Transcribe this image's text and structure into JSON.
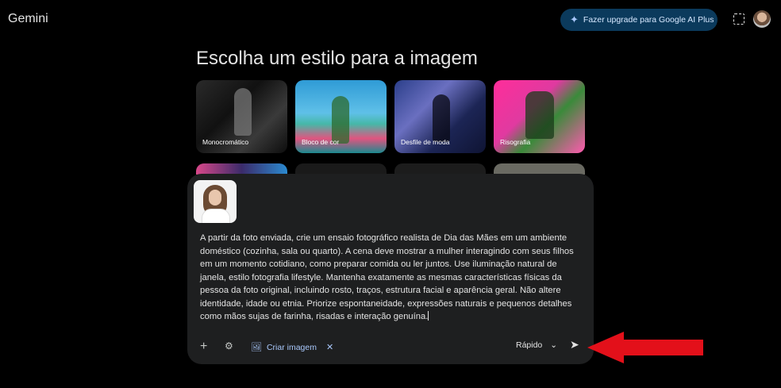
{
  "header": {
    "app_title": "Gemini",
    "upgrade_label": "Fazer upgrade para Google AI Plus"
  },
  "main": {
    "heading": "Escolha um estilo para a imagem",
    "styles": [
      {
        "label": "Monocromático"
      },
      {
        "label": "Bloco de cor"
      },
      {
        "label": "Desfile de moda"
      },
      {
        "label": "Risografia"
      }
    ]
  },
  "composer": {
    "prompt": "A partir da foto enviada, crie um ensaio fotográfico realista de Dia das Mães em um ambiente doméstico (cozinha, sala ou quarto). A cena deve mostrar a mulher interagindo com seus filhos em um momento cotidiano, como preparar comida ou ler juntos. Use iluminação natural de janela, estilo fotografia lifestyle. Mantenha exatamente as mesmas características físicas da pessoa da foto original, incluindo rosto, traços, estrutura facial e aparência geral. Não altere identidade, idade ou etnia. Priorize espontaneidade, expressões naturais e pequenos detalhes como mãos sujas de farinha, risadas e interação genuína.",
    "create_image_label": "Criar imagem",
    "model_label": "Rápido"
  },
  "colors": {
    "background": "#000000",
    "composer_bg": "#1e1f20",
    "accent": "#a8c7fa",
    "upgrade_bg": "#0b3a5c",
    "annotation_arrow": "#e3101a"
  },
  "icons": [
    "sparkle-icon",
    "screen-capture-icon",
    "plus-icon",
    "tools-icon",
    "image-icon",
    "close-icon",
    "chevron-down-icon",
    "send-icon",
    "red-arrow-annotation"
  ]
}
